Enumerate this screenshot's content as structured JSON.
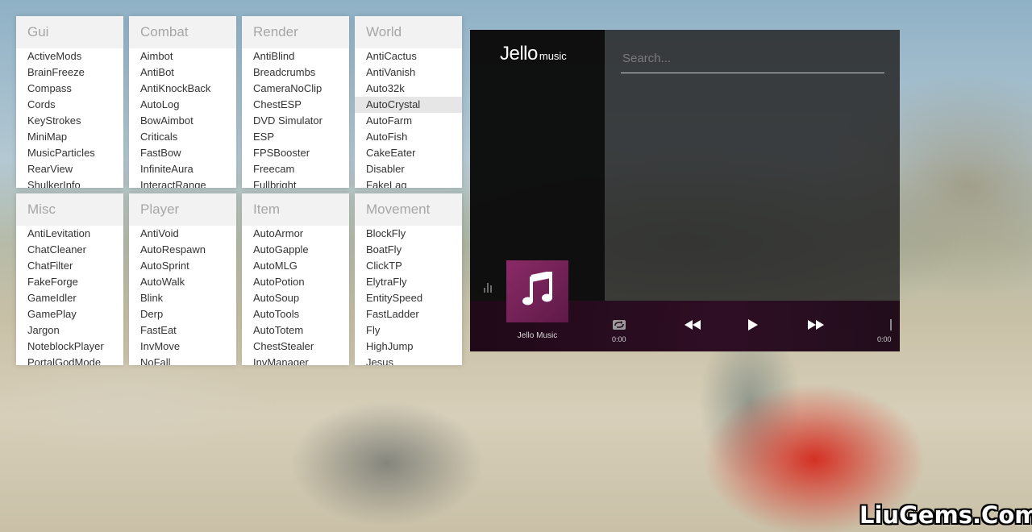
{
  "categories": [
    {
      "title": "Gui",
      "items": [
        "ActiveMods",
        "BrainFreeze",
        "Compass",
        "Cords",
        "KeyStrokes",
        "MiniMap",
        "MusicParticles",
        "RearView",
        "ShulkerInfo"
      ]
    },
    {
      "title": "Combat",
      "items": [
        "Aimbot",
        "AntiBot",
        "AntiKnockBack",
        "AutoLog",
        "BowAimbot",
        "Criticals",
        "FastBow",
        "InfiniteAura",
        "InteractRange"
      ]
    },
    {
      "title": "Render",
      "items": [
        "AntiBlind",
        "Breadcrumbs",
        "CameraNoClip",
        "ChestESP",
        "DVD Simulator",
        "ESP",
        "FPSBooster",
        "Freecam",
        "Fullbright"
      ]
    },
    {
      "title": "World",
      "items": [
        "AntiCactus",
        "AntiVanish",
        "Auto32k",
        "AutoCrystal",
        "AutoFarm",
        "AutoFish",
        "CakeEater",
        "Disabler",
        "FakeLag"
      ]
    },
    {
      "title": "Misc",
      "items": [
        "AntiLevitation",
        "ChatCleaner",
        "ChatFilter",
        "FakeForge",
        "GameIdler",
        "GamePlay",
        "Jargon",
        "NoteblockPlayer",
        "PortalGodMode"
      ]
    },
    {
      "title": "Player",
      "items": [
        "AntiVoid",
        "AutoRespawn",
        "AutoSprint",
        "AutoWalk",
        "Blink",
        "Derp",
        "FastEat",
        "InvMove",
        "NoFall"
      ]
    },
    {
      "title": "Item",
      "items": [
        "AutoArmor",
        "AutoGapple",
        "AutoMLG",
        "AutoPotion",
        "AutoSoup",
        "AutoTools",
        "AutoTotem",
        "ChestStealer",
        "InvManager"
      ]
    },
    {
      "title": "Movement",
      "items": [
        "BlockFly",
        "BoatFly",
        "ClickTP",
        "ElytraFly",
        "EntitySpeed",
        "FastLadder",
        "Fly",
        "HighJump",
        "Jesus"
      ]
    }
  ],
  "highlighted": "AutoCrystal",
  "music": {
    "logo_main": "Jello",
    "logo_sub": "music",
    "search_placeholder": "Search...",
    "album_label": "Jello Music",
    "time_current": "0:00",
    "time_total": "0:00",
    "accent_color": "#7a2058"
  },
  "icons": {
    "album": "music-note-icon",
    "repeat": "repeat-icon",
    "rewind": "rewind-icon",
    "play": "play-icon",
    "forward": "fast-forward-icon",
    "equalizer": "equalizer-icon"
  },
  "watermark": "LiuGems.Com"
}
